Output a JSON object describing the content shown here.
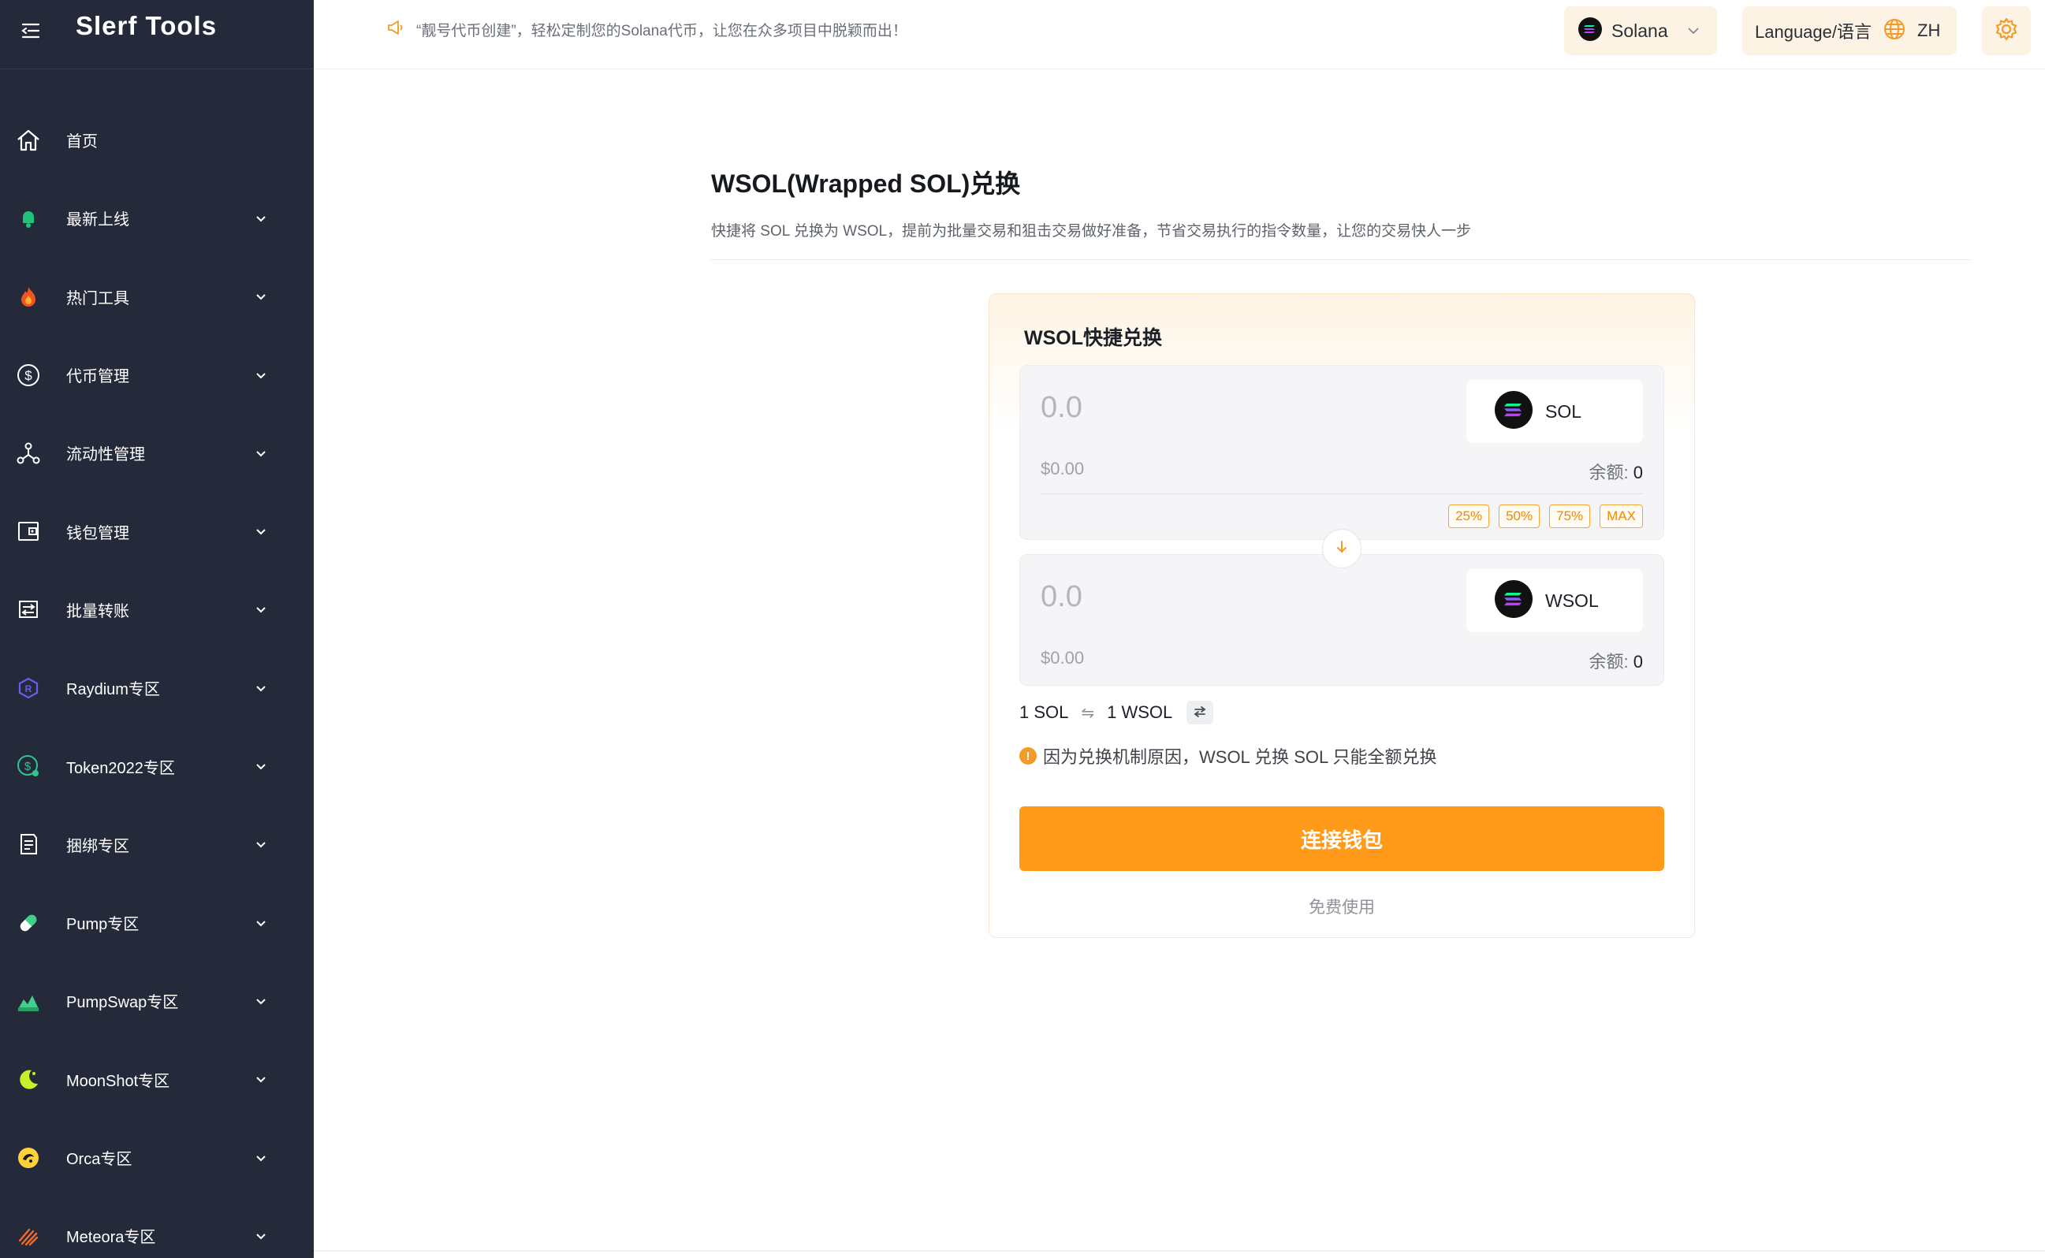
{
  "app": {
    "logo_text": "Slerf Tools",
    "brand_color": "#ff9a1a",
    "sidebar_bg": "#252a3b"
  },
  "topbar": {
    "announcement": "“靓号代币创建”，轻松定制您的Solana代币，让您在众多项目中脱颖而出！",
    "announcement_icon": "megaphone-icon",
    "chain_label": "Solana",
    "language_label": "Language/语言",
    "language_code": "ZH",
    "settings_icon": "gear-icon"
  },
  "sidebar": {
    "items": [
      {
        "label": "首页",
        "icon": "home-icon",
        "has_submenu": false
      },
      {
        "label": "最新上线",
        "icon": "bell-icon",
        "has_submenu": true
      },
      {
        "label": "热门工具",
        "icon": "fire-icon",
        "has_submenu": true
      },
      {
        "label": "代币管理",
        "icon": "dollar-circle-icon",
        "has_submenu": true
      },
      {
        "label": "流动性管理",
        "icon": "nodes-icon",
        "has_submenu": true
      },
      {
        "label": "钱包管理",
        "icon": "wallet-icon",
        "has_submenu": true
      },
      {
        "label": "批量转账",
        "icon": "transfer-icon",
        "has_submenu": true
      },
      {
        "label": "Raydium专区",
        "icon": "raydium-icon",
        "has_submenu": true
      },
      {
        "label": "Token2022专区",
        "icon": "token2022-icon",
        "has_submenu": true
      },
      {
        "label": "捆绑专区",
        "icon": "bundle-icon",
        "has_submenu": true
      },
      {
        "label": "Pump专区",
        "icon": "pill-icon",
        "has_submenu": true
      },
      {
        "label": "PumpSwap专区",
        "icon": "pumpswap-icon",
        "has_submenu": true
      },
      {
        "label": "MoonShot专区",
        "icon": "moon-icon",
        "has_submenu": true
      },
      {
        "label": "Orca专区",
        "icon": "orca-icon",
        "has_submenu": true
      },
      {
        "label": "Meteora专区",
        "icon": "meteora-icon",
        "has_submenu": true
      }
    ]
  },
  "main": {
    "title": "WSOL(Wrapped SOL)兑换",
    "description": "快捷将 SOL 兑换为 WSOL，提前为批量交易和狙击交易做好准备，节省交易执行的指令数量，让您的交易快人一步",
    "card": {
      "title": "WSOL快捷兑换",
      "from": {
        "placeholder": "0.0",
        "token": "SOL",
        "usd_value": "$0.00",
        "balance_label": "余额:",
        "balance_value": "0",
        "percent_buttons": [
          "25%",
          "50%",
          "75%",
          "MAX"
        ]
      },
      "to": {
        "placeholder": "0.0",
        "token": "WSOL",
        "usd_value": "$0.00",
        "balance_label": "余额:",
        "balance_value": "0"
      },
      "rate_left": "1 SOL",
      "rate_symbol": "⇋",
      "rate_right": "1 WSOL",
      "notice_mark": "!",
      "notice": "因为兑换机制原因，WSOL 兑换 SOL 只能全额兑换",
      "connect_button": "连接钱包",
      "free_text": "免费使用"
    }
  }
}
